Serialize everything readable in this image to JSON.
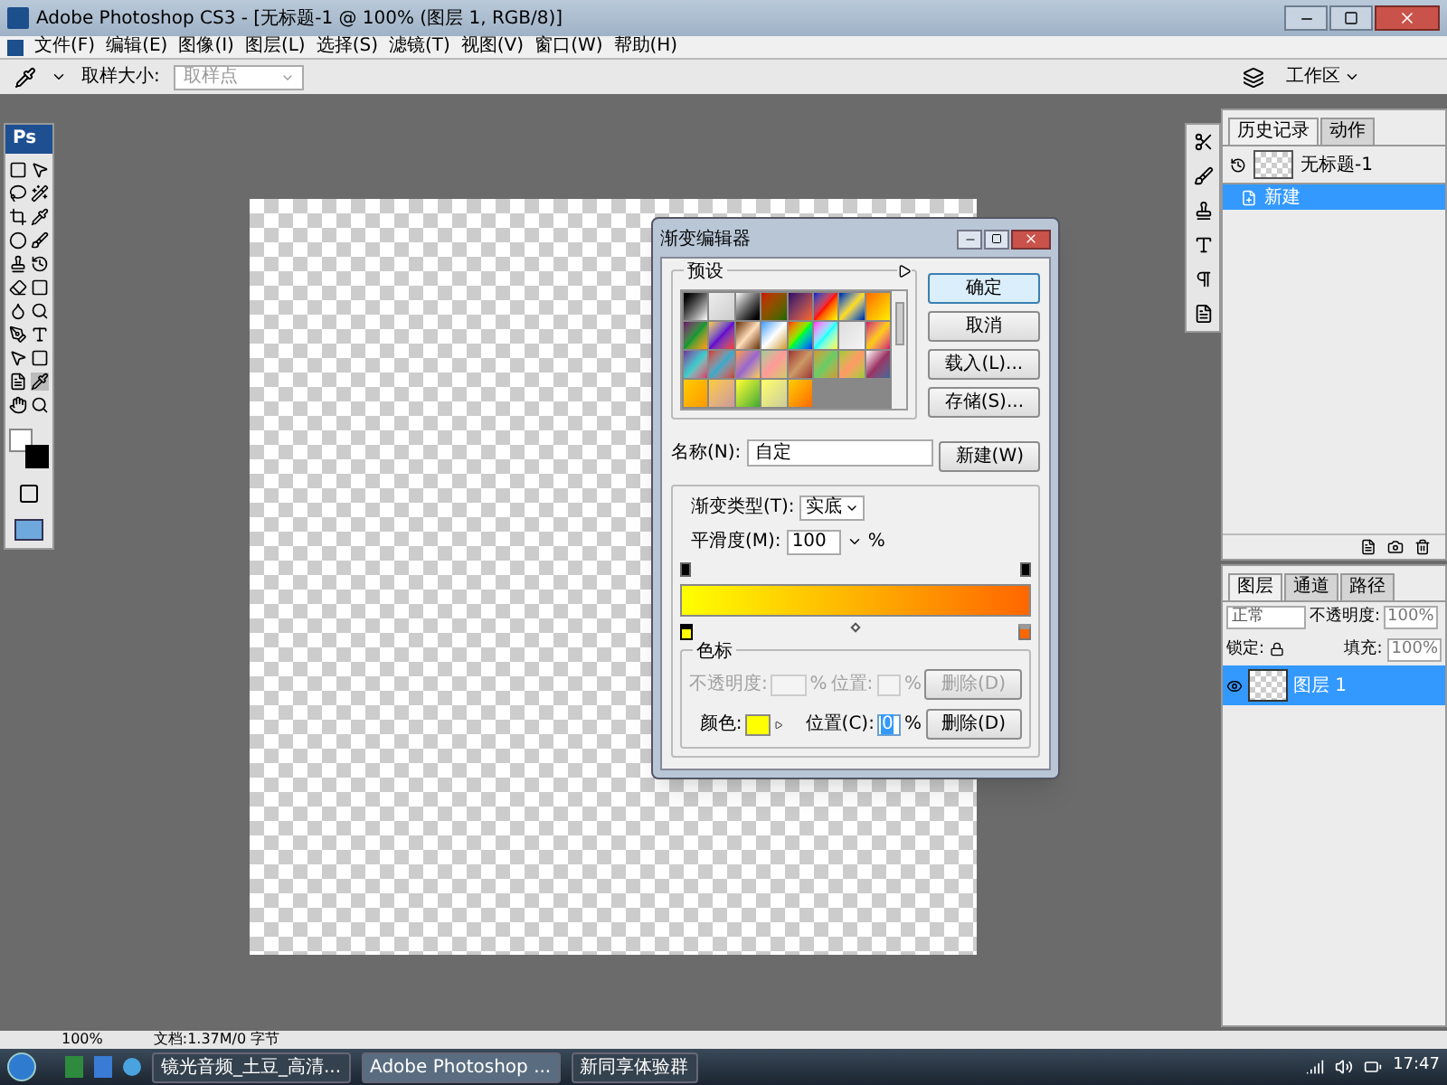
{
  "window": {
    "title": "Adobe Photoshop CS3 - [无标题-1 @ 100% (图层 1, RGB/8)]"
  },
  "menu": [
    "文件(F)",
    "编辑(E)",
    "图像(I)",
    "图层(L)",
    "选择(S)",
    "滤镜(T)",
    "视图(V)",
    "窗口(W)",
    "帮助(H)"
  ],
  "options_bar": {
    "sample_size_label": "取样大小:",
    "sample_size_value": "取样点",
    "workspace": "工作区"
  },
  "toolbox": {
    "logo": "Ps"
  },
  "gradient_editor": {
    "title": "渐变编辑器",
    "presets_label": "预设",
    "buttons": [
      "确定",
      "取消",
      "载入(L)...",
      "存储(S)..."
    ],
    "name_label": "名称(N):",
    "name_value": "自定",
    "new_button": "新建(W)",
    "type_label": "渐变类型(T):",
    "type_value": "实底",
    "smoothness_label": "平滑度(M):",
    "smoothness_value": "100",
    "smoothness_unit": "%",
    "color_stops": [
      {
        "color": "#ffff00",
        "selected": true
      },
      {
        "color": "#ff6600",
        "selected": false
      }
    ],
    "stops_group": {
      "title": "色标",
      "opacity_row": {
        "disabled": true,
        "label": "不透明度:",
        "unit": "%",
        "location_label": "位置:",
        "location_unit": "%",
        "delete": "删除(D)"
      },
      "color_row": {
        "disabled": false,
        "label": "颜色:",
        "color": "#ffff00",
        "location_label": "位置(C):",
        "location_value": "0",
        "location_unit": "%",
        "delete": "删除(D)"
      }
    }
  },
  "history_panel": {
    "tabs": [
      {
        "label": "历史记录",
        "selected": true
      },
      {
        "label": "动作",
        "selected": false
      }
    ],
    "snapshot": "无标题-1",
    "items": [
      {
        "label": "新建",
        "selected": true
      }
    ]
  },
  "layers_panel": {
    "tabs": [
      {
        "label": "图层",
        "selected": true
      },
      {
        "label": "通道",
        "selected": false
      },
      {
        "label": "路径",
        "selected": false
      }
    ],
    "blend_mode": "正常",
    "opacity_label": "不透明度:",
    "opacity_value": "100%",
    "lock_label": "锁定:",
    "fill_label": "填充:",
    "fill_value": "100%",
    "layers": [
      {
        "name": "图层 1",
        "selected": true
      }
    ]
  },
  "status_bar": {
    "zoom": "100%",
    "doc_info": "文档:1.37M/0 字节"
  },
  "taskbar": {
    "tasks": [
      {
        "label": "镜光音频_土豆_高清...",
        "selected": false
      },
      {
        "label": "Adobe Photoshop ...",
        "selected": true
      },
      {
        "label": "新同享体验群",
        "selected": false
      }
    ],
    "clock": "17:47"
  }
}
